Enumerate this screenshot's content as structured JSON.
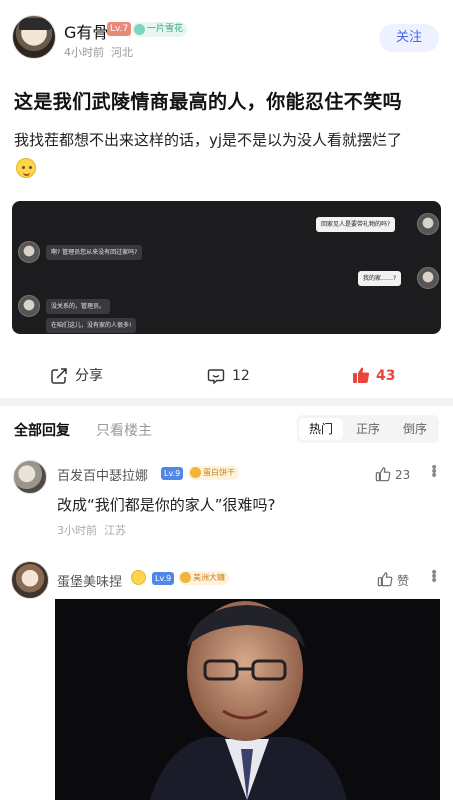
{
  "author": {
    "name": "G有骨",
    "level": "Lv.7",
    "tag": "一片雪花",
    "time": "4小时前",
    "location": "河北",
    "follow_label": "关注"
  },
  "post": {
    "title": "这是我们武陵情商最高的人，你能忍住不笑吗",
    "body": "我找茬都想不出来这样的话，yj是不是以为没人看就摆烂了"
  },
  "chat_image": {
    "messages": [
      {
        "side": "right",
        "text": "回家见人是要带礼物的吗?"
      },
      {
        "side": "left",
        "text": "啊? 管理员您从来没有回过家吗?"
      },
      {
        "side": "right",
        "text": "我的家……?"
      },
      {
        "side": "left",
        "text": "没关系的，管理员。"
      },
      {
        "side": "left",
        "text": "在咱们这儿，没有家的人很多!"
      }
    ]
  },
  "actions": {
    "share_label": "分享",
    "comment_count": "12",
    "like_count": "43"
  },
  "reply_tabs": {
    "all": "全部回复",
    "owner_only": "只看楼主",
    "sort": [
      "热门",
      "正序",
      "倒序"
    ]
  },
  "comments": [
    {
      "name": "百发百中瑟拉娜",
      "level": "Lv.9",
      "tag": "蛋白饼干",
      "text": "改成“我们都是你的家人”很难吗?",
      "time": "3小时前",
      "location": "江苏",
      "likes": "23"
    },
    {
      "name": "蛋堡美味捏",
      "level": "Lv.9",
      "tag": "美洲大蠊",
      "likes": "赞"
    }
  ],
  "colors": {
    "accent": "#4c64e8",
    "like_red": "#e8453c",
    "gold": "#f0b43a"
  }
}
